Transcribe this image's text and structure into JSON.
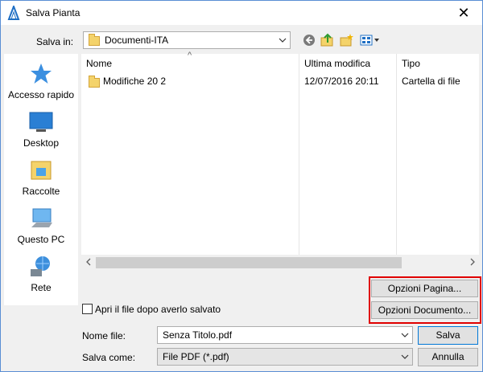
{
  "window": {
    "title": "Salva Pianta",
    "close_glyph": "✕"
  },
  "toolbar": {
    "save_in_label": "Salva in:",
    "save_in_value": "Documenti-ITA",
    "icons": [
      "back-icon",
      "up-folder-icon",
      "new-folder-icon",
      "view-menu-icon"
    ]
  },
  "places": [
    {
      "label": "Accesso rapido",
      "icon": "star-icon"
    },
    {
      "label": "Desktop",
      "icon": "desktop-icon"
    },
    {
      "label": "Raccolte",
      "icon": "libraries-icon"
    },
    {
      "label": "Questo PC",
      "icon": "computer-icon"
    },
    {
      "label": "Rete",
      "icon": "network-icon"
    }
  ],
  "file_list": {
    "columns": [
      "Nome",
      "Ultima modifica",
      "Tipo"
    ],
    "sort_indicator": "^",
    "rows": [
      {
        "name": "Modifiche 20 2",
        "modified": "12/07/2016 20:11",
        "type": "Cartella di file"
      }
    ]
  },
  "options": {
    "page_button": "Opzioni Pagina...",
    "document_button": "Opzioni Documento..."
  },
  "open_after_save": {
    "label": "Apri il file dopo averlo salvato",
    "checked": false
  },
  "filename": {
    "label": "Nome file:",
    "value": "Senza Titolo.pdf"
  },
  "save_as": {
    "label": "Salva come:",
    "value": "File PDF (*.pdf)"
  },
  "buttons": {
    "save": "Salva",
    "cancel": "Annulla"
  },
  "colors": {
    "accent": "#0078d7",
    "highlight_box": "#e00000",
    "folder": "#f4d36b"
  }
}
